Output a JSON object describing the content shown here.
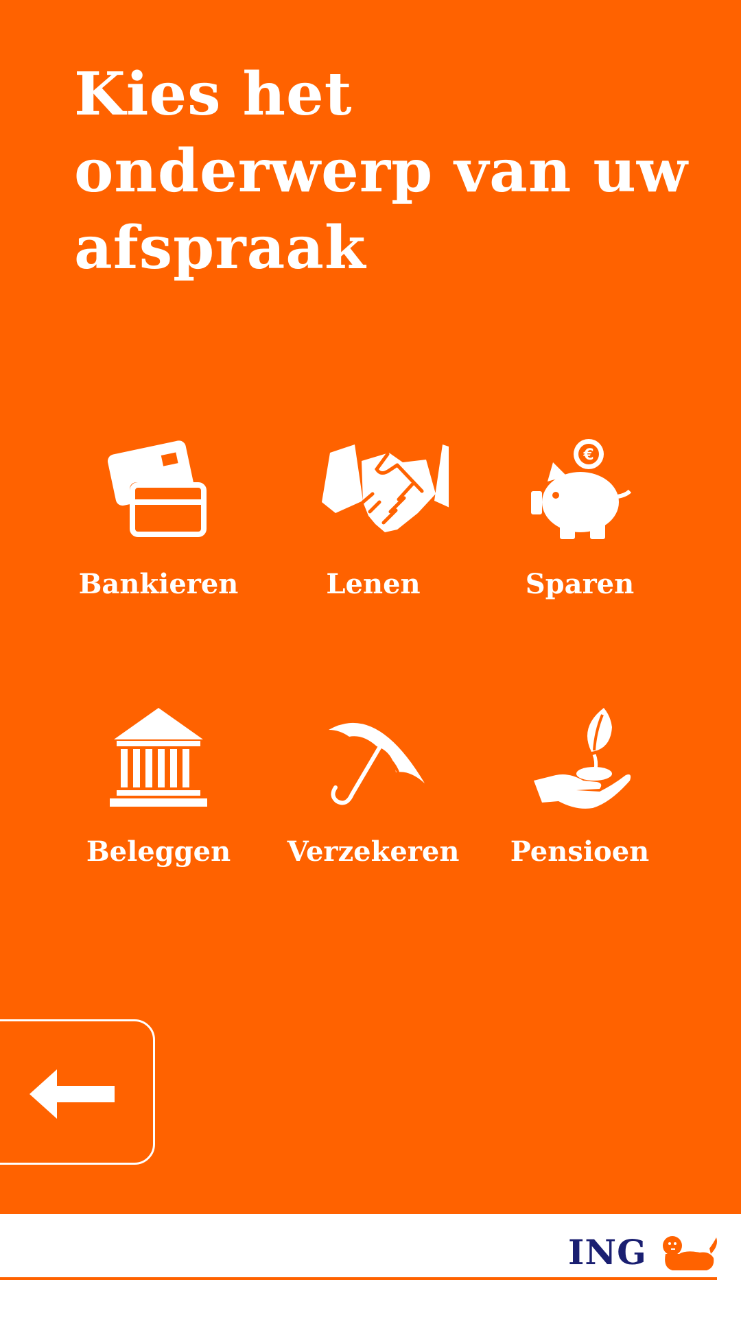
{
  "header": {
    "title": "Kies het onderwerp van uw afspraak"
  },
  "topics": [
    {
      "label": "Bankieren",
      "icon": "credit-card-icon"
    },
    {
      "label": "Lenen",
      "icon": "handshake-icon"
    },
    {
      "label": "Sparen",
      "icon": "piggy-bank-icon"
    },
    {
      "label": "Beleggen",
      "icon": "bank-building-icon"
    },
    {
      "label": "Verzekeren",
      "icon": "umbrella-icon"
    },
    {
      "label": "Pensioen",
      "icon": "plant-in-hand-icon"
    }
  ],
  "back": {
    "icon": "arrow-left-icon"
  },
  "brand": {
    "name": "ING",
    "logo_icon": "lion-icon"
  },
  "colors": {
    "accent": "#ff6200",
    "brand_blue": "#1a1f71",
    "background": "#ffffff"
  }
}
